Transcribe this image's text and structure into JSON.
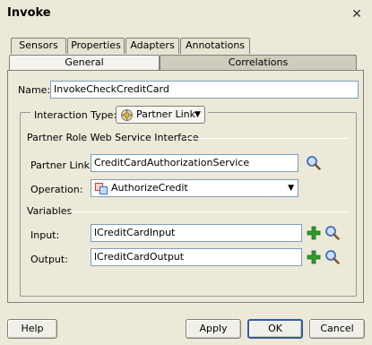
{
  "dialog": {
    "title": "Invoke"
  },
  "tabs_top": [
    {
      "label": "Sensors"
    },
    {
      "label": "Properties"
    },
    {
      "label": "Adapters"
    },
    {
      "label": "Annotations"
    }
  ],
  "tabs_bottom": [
    {
      "label": "General",
      "active": true
    },
    {
      "label": "Correlations",
      "active": false
    }
  ],
  "general": {
    "name_label": "Name:",
    "name_value": "InvokeCheckCreditCard",
    "interaction_type_label": "Interaction Type:",
    "interaction_type_value": "Partner Link",
    "partner_section_title": "Partner Role Web Service Interface",
    "partner_link_label": "Partner Link:",
    "partner_link_value": "CreditCardAuthorizationService",
    "operation_label": "Operation:",
    "operation_value": "AuthorizeCredit",
    "variables_title": "Variables",
    "input_label": "Input:",
    "input_value": "lCreditCardInput",
    "output_label": "Output:",
    "output_value": "lCreditCardOutput"
  },
  "buttons": {
    "help": "Help",
    "apply": "Apply",
    "ok": "OK",
    "cancel": "Cancel"
  },
  "colors": {
    "accent_green": "#2e9b2e",
    "search_blue": "#3a6fc4",
    "operation_icon_red": "#d23a2a"
  }
}
